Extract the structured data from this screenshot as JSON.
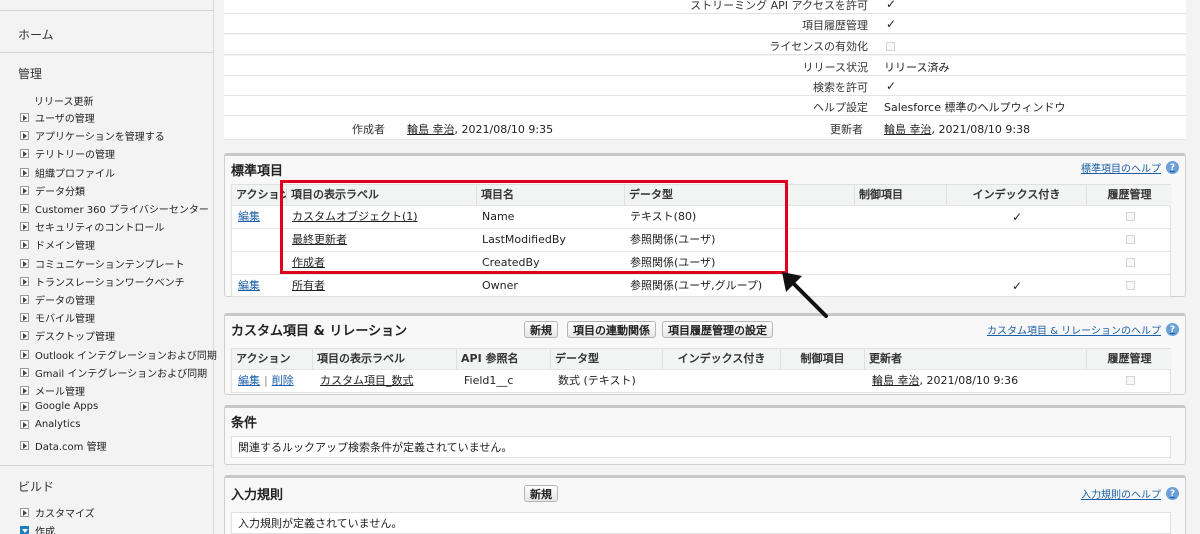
{
  "sidebar": {
    "home": "ホーム",
    "admin_heading": "管理",
    "release_updates": "リリース更新",
    "items": [
      "ユーザの管理",
      "アプリケーションを管理する",
      "テリトリーの管理",
      "組織プロファイル",
      "データ分類",
      "Customer 360 プライバシーセンター",
      "セキュリティのコントロール",
      "ドメイン管理",
      "コミュニケーションテンプレート",
      "トランスレーションワークベンチ",
      "データの管理",
      "モバイル管理",
      "デスクトップ管理",
      "Outlook インテグレーションおよび同期",
      "Gmail インテグレーションおよび同期",
      "メール管理",
      "Google Apps",
      "Analytics",
      "Data.com 管理"
    ],
    "build_heading": "ビルド",
    "build_items": [
      "カスタマイズ",
      "作成"
    ]
  },
  "details": {
    "streaming_label": "ストリーミング API アクセスを許可",
    "history_label": "項目履歴管理",
    "license_label": "ライセンスの有効化",
    "release_label": "リリース状況",
    "release_value": "リリース済み",
    "search_label": "検索を許可",
    "help_label": "ヘルプ設定",
    "help_value": "Salesforce 標準のヘルプウィンドウ",
    "created_label": "作成者",
    "created_user": "輪島 幸治",
    "created_date": ", 2021/08/10 9:35",
    "modified_label": "更新者",
    "modified_user": "輪島 幸治",
    "modified_date": ", 2021/08/10 9:38"
  },
  "standard_fields": {
    "title": "標準項目",
    "help": "標準項目のヘルプ",
    "columns": [
      "アクション",
      "項目の表示ラベル",
      "項目名",
      "データ型",
      "制御項目",
      "インデックス付き",
      "履歴管理"
    ],
    "rows": [
      {
        "action": "編集",
        "label": "カスタムオブジェクト(1)",
        "name": "Name",
        "type": "テキスト(80)",
        "indexed": true
      },
      {
        "action": "",
        "label": "最終更新者",
        "name": "LastModifiedBy",
        "type": "参照関係(ユーザ)",
        "indexed": false
      },
      {
        "action": "",
        "label": "作成者",
        "name": "CreatedBy",
        "type": "参照関係(ユーザ)",
        "indexed": false
      },
      {
        "action": "編集",
        "label": "所有者",
        "name": "Owner",
        "type": "参照関係(ユーザ,グループ)",
        "indexed": true
      }
    ]
  },
  "custom_fields": {
    "title": "カスタム項目 & リレーション",
    "buttons": [
      "新規",
      "項目の連動関係",
      "項目履歴管理の設定"
    ],
    "help": "カスタム項目 & リレーションのヘルプ",
    "columns": [
      "アクション",
      "項目の表示ラベル",
      "API 参照名",
      "データ型",
      "インデックス付き",
      "制御項目",
      "更新者",
      "履歴管理"
    ],
    "row": {
      "edit": "編集",
      "delete": "削除",
      "label": "カスタム項目_数式",
      "api": "Field1__c",
      "type": "数式 (テキスト)",
      "modified_user": "輪島 幸治",
      "modified_date": ", 2021/08/10 9:36"
    }
  },
  "conditions": {
    "title": "条件",
    "empty": "関連するルックアップ検索条件が定義されていません。"
  },
  "validation": {
    "title": "入力規則",
    "new_button": "新規",
    "help": "入力規則のヘルプ",
    "empty": "入力規則が定義されていません。"
  },
  "check_glyph": "✓",
  "help_glyph": "?",
  "colors": {
    "highlight": "#e0001b",
    "link": "#1a5fa8"
  }
}
